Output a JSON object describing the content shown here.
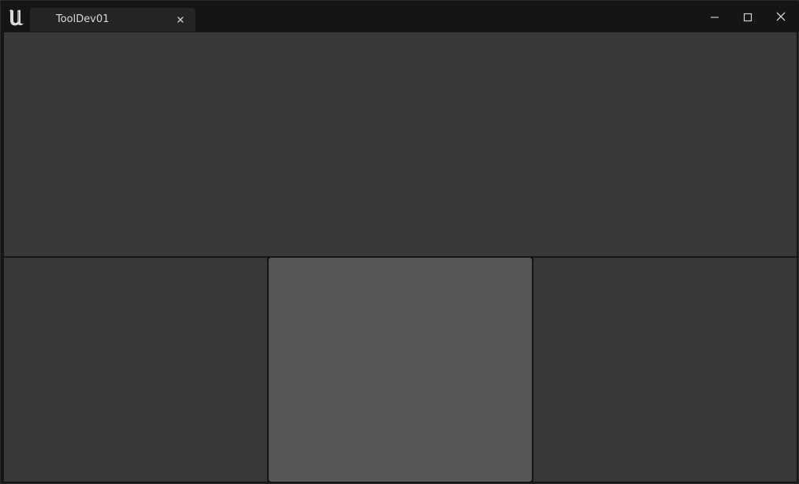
{
  "window": {
    "tab_title": "ToolDev01",
    "logo_icon": "unreal-engine-logo-icon",
    "close_tab_icon": "close-icon",
    "minimize_icon": "minimize-icon",
    "maximize_icon": "maximize-icon",
    "close_window_icon": "close-icon"
  },
  "colors": {
    "titlebar": "#151515",
    "tab": "#242424",
    "panel": "#383838",
    "panel_active": "#575757"
  },
  "layout": {
    "panels": [
      "top-panel",
      "bottom-left-panel",
      "bottom-center-panel",
      "bottom-right-panel"
    ],
    "active_panel": "bottom-center-panel"
  }
}
